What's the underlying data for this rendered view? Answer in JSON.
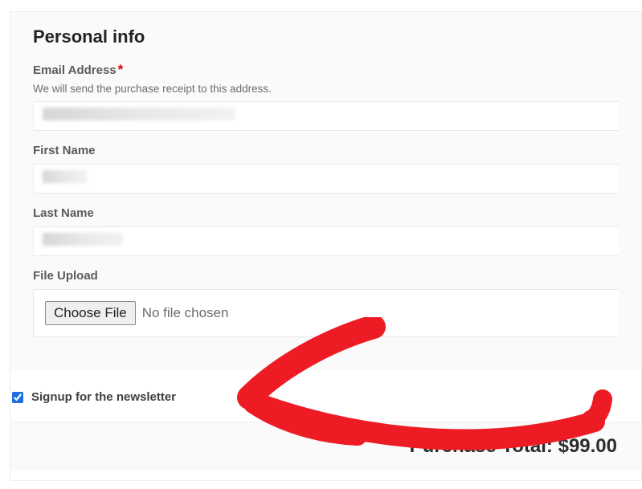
{
  "section": {
    "title": "Personal info"
  },
  "email": {
    "label": "Email Address",
    "required_mark": "*",
    "description": "We will send the purchase receipt to this address.",
    "value": ""
  },
  "first_name": {
    "label": "First Name",
    "value": ""
  },
  "last_name": {
    "label": "Last Name",
    "value": ""
  },
  "file_upload": {
    "label": "File Upload",
    "button_label": "Choose File",
    "status_text": "No file chosen"
  },
  "newsletter": {
    "label": "Signup for the newsletter",
    "checked": true
  },
  "total": {
    "label": "Purchase Total:",
    "amount": "$99.00"
  },
  "annotation": {
    "name": "red-arrow-annotation",
    "color": "#ed1c24"
  }
}
